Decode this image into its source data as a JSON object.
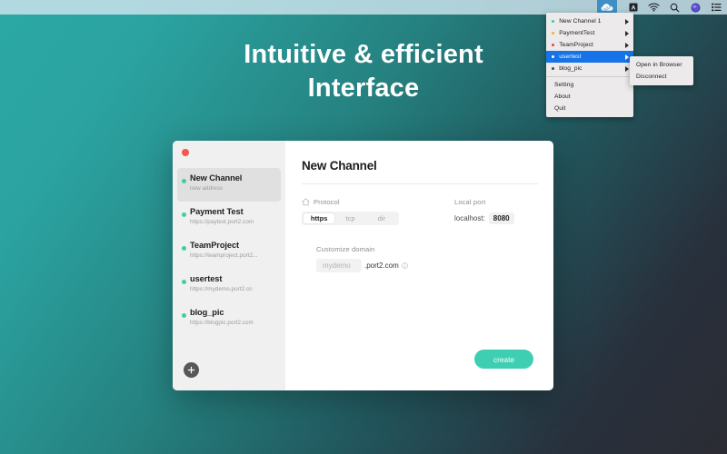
{
  "menubar": {
    "app_icon": "cloud-icon",
    "items": [
      {
        "name": "input-source-icon",
        "glyph": "A"
      },
      {
        "name": "wifi-icon",
        "glyph": "wifi"
      },
      {
        "name": "spotlight-search-icon",
        "glyph": "search"
      },
      {
        "name": "siri-icon",
        "glyph": "siri"
      },
      {
        "name": "control-center-icon",
        "glyph": "list"
      }
    ]
  },
  "menu": {
    "channels": [
      {
        "label": "New Channel 1",
        "dot_color": "#39c9a6",
        "selected": false
      },
      {
        "label": "PaymentTest",
        "dot_color": "#f0b429",
        "selected": false
      },
      {
        "label": "TeamProject",
        "dot_color": "#e8453c",
        "selected": false
      },
      {
        "label": "usertest",
        "dot_color": "#ffffff",
        "selected": true
      },
      {
        "label": "blog_pic",
        "dot_color": "#4a4a4a",
        "selected": false
      }
    ],
    "actions": [
      {
        "label": "Setting"
      },
      {
        "label": "About"
      },
      {
        "label": "Quit"
      }
    ],
    "highlight_color": "#1673e8"
  },
  "submenu": {
    "items": [
      {
        "label": "Open in Browser"
      },
      {
        "label": "Disconnect"
      }
    ]
  },
  "headline": {
    "line1": "Intuitive & efficient",
    "line2": "Interface"
  },
  "app": {
    "sidebar": {
      "channels": [
        {
          "name": "New Channel",
          "address": "new address",
          "active": true,
          "dot_color": "#3ecfa0"
        },
        {
          "name": "Payment Test",
          "address": "https://paytest.port2.com",
          "active": false,
          "dot_color": "#3ecfa0"
        },
        {
          "name": "TeamProject",
          "address": "https://teamproject.port2...",
          "active": false,
          "dot_color": "#3ecfa0"
        },
        {
          "name": "usertest",
          "address": "https://mydemo.port2.cn",
          "active": false,
          "dot_color": "#3ecfa0"
        },
        {
          "name": "blog_pic",
          "address": "https://blogpic.port2.com",
          "active": false,
          "dot_color": "#3ecfa0"
        }
      ],
      "add_label": "+"
    },
    "detail": {
      "title": "New Channel",
      "protocol_label": "Protocol",
      "protocol_options": [
        {
          "label": "https",
          "selected": true
        },
        {
          "label": "tcp",
          "selected": false
        },
        {
          "label": "dir",
          "selected": false
        }
      ],
      "local_port_label": "Local port",
      "localhost_prefix": "localhost:",
      "local_port_value": "8080",
      "domain_label": "Customize domain",
      "domain_value": "mydemo",
      "domain_suffix": ".port2.com",
      "create_label": "create",
      "accent_color": "#3ecfb2"
    }
  }
}
